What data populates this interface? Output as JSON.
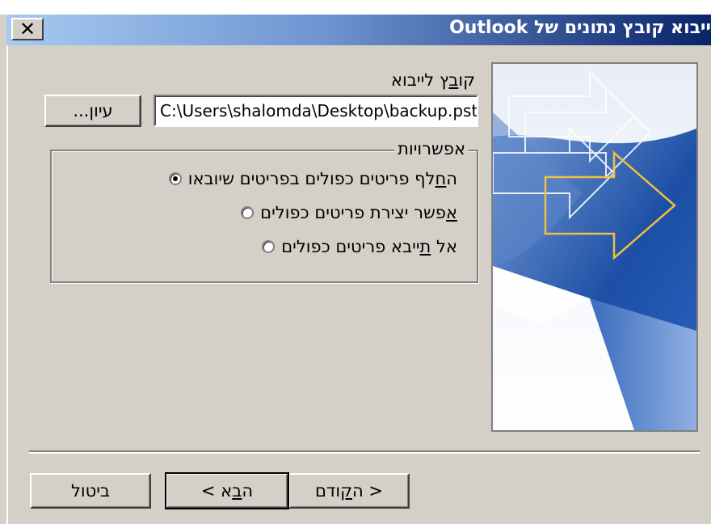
{
  "dialog": {
    "title": "ייבוא קובץ נתונים של Outlook",
    "close_symbol": "✕"
  },
  "file": {
    "label_prefix": "קו",
    "label_hotkey": "ב",
    "label_suffix": "ץ לייבוא",
    "path_value": "C:\\Users\\shalomda\\Desktop\\backup.pst",
    "browse_label_prefix": "עיו",
    "browse_label_hotkey": "ן",
    "browse_label_suffix": "..."
  },
  "options": {
    "group_title": "אפשרויות",
    "items": [
      {
        "prefix": "ה",
        "hotkey": "ח",
        "suffix": "לף פריטים כפולים בפריטים שיובאו",
        "checked": true
      },
      {
        "prefix": "",
        "hotkey": "א",
        "suffix": "פשר יצירת פריטים כפולים",
        "checked": false
      },
      {
        "prefix": "אל ",
        "hotkey": "ת",
        "suffix": "ייבא פריטים כפולים",
        "checked": false
      }
    ]
  },
  "footer": {
    "back_prefix": "< ה",
    "back_hotkey": "ק",
    "back_suffix": "ודם",
    "next_prefix": "ה",
    "next_hotkey": "ב",
    "next_suffix": "א >",
    "cancel_label": "ביטול"
  },
  "colors": {
    "titlebar_start": "#a6caf0",
    "titlebar_end": "#0a246a",
    "dialog_face": "#d4d0c8",
    "image_blue": "#1c4fa5",
    "arrow_outline_yellow": "#f0c040"
  },
  "icons": {
    "close": "close-icon",
    "image": "wizard-arrows-image"
  }
}
